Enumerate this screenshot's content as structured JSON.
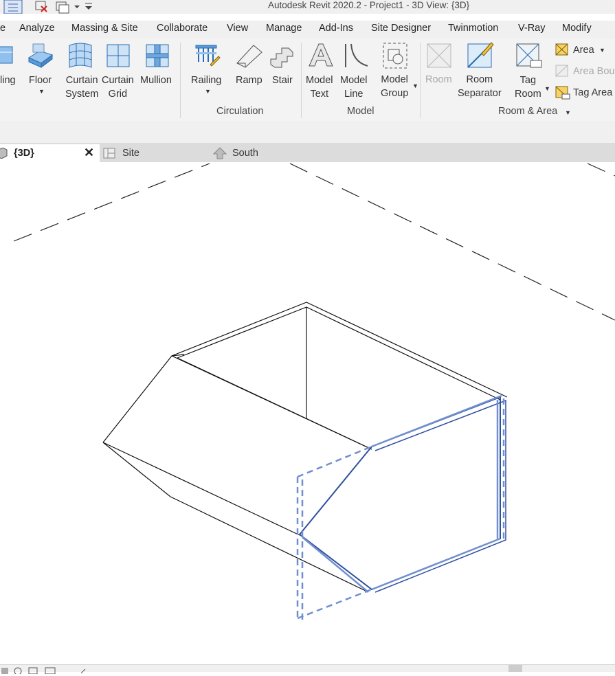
{
  "window": {
    "title": "Autodesk Revit 2020.2 - Project1 - 3D View: {3D}"
  },
  "menu": {
    "items": [
      "e",
      "Analyze",
      "Massing & Site",
      "Collaborate",
      "View",
      "Manage",
      "Add-Ins",
      "Site Designer",
      "Twinmotion",
      "V-Ray",
      "Modify"
    ]
  },
  "ribbon": {
    "build": {
      "partial_label": "ling",
      "floor_label": "Floor",
      "curtain_system_label": [
        "Curtain",
        "System"
      ],
      "curtain_grid_label": [
        "Curtain",
        "Grid"
      ],
      "mullion_label": "Mullion"
    },
    "circulation": {
      "title": "Circulation",
      "railing_label": "Railing",
      "ramp_label": "Ramp",
      "stair_label": "Stair"
    },
    "model": {
      "title": "Model",
      "model_text_label": [
        "Model",
        "Text"
      ],
      "model_line_label": [
        "Model",
        "Line"
      ],
      "model_group_label": [
        "Model",
        "Group"
      ]
    },
    "room_area": {
      "title": "Room & Area",
      "room_label": "Room",
      "room_separator_label": [
        "Room",
        "Separator"
      ],
      "tag_room_label": [
        "Tag",
        "Room"
      ],
      "area_label": "Area",
      "area_boundary_label": "Area Bou",
      "tag_area_label": [
        "Tag",
        "Area"
      ]
    }
  },
  "tabs": [
    {
      "label": "{3D}",
      "active": true
    },
    {
      "label": "Site",
      "active": false
    },
    {
      "label": "South",
      "active": false
    }
  ],
  "colors": {
    "selection": "#6f8fcf",
    "selection_dark": "#2f4f9f",
    "ribbon_bg": "#f3f3f3",
    "tab_bg": "#dcdcdc"
  }
}
